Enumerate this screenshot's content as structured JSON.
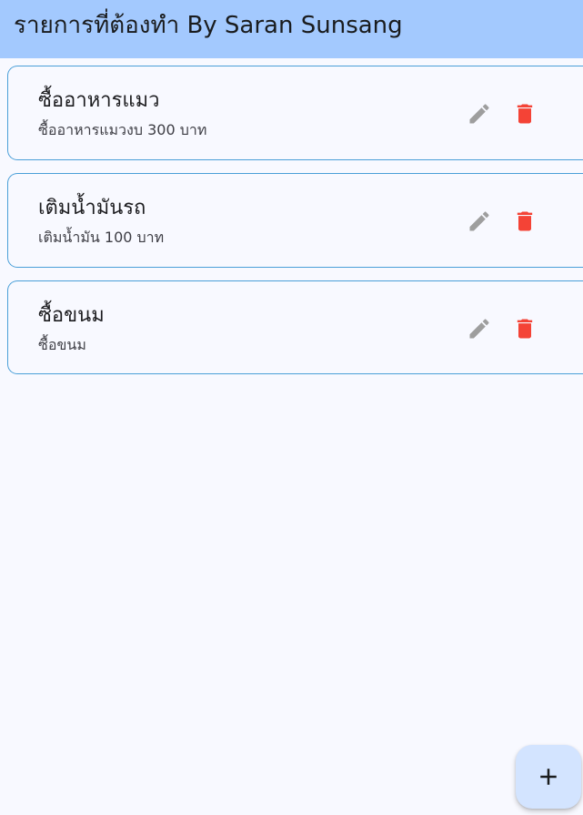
{
  "app_bar": {
    "title": "รายการที่ต้องทำ By Saran Sunsang"
  },
  "todos": [
    {
      "title": "ซื้ออาหารแมว",
      "subtitle": "ซื้ออาหารแมวงบ 300 บาท",
      "edit_icon": "pencil-icon",
      "delete_icon": "trash-icon"
    },
    {
      "title": "เติมน้ำมันรถ",
      "subtitle": "เติมน้ำมัน 100 บาท",
      "edit_icon": "pencil-icon",
      "delete_icon": "trash-icon"
    },
    {
      "title": "ซื้อขนม",
      "subtitle": "ซื้อขนม",
      "edit_icon": "pencil-icon",
      "delete_icon": "trash-icon"
    }
  ],
  "fab": {
    "icon": "plus-icon"
  },
  "colors": {
    "app_bar_background": "#a3c9fe",
    "page_background": "#f8f9ff",
    "card_border": "#4a9fd8",
    "edit_icon": "#9e9e9e",
    "delete_icon": "#f44336",
    "fab_background": "#d3e4ff"
  }
}
